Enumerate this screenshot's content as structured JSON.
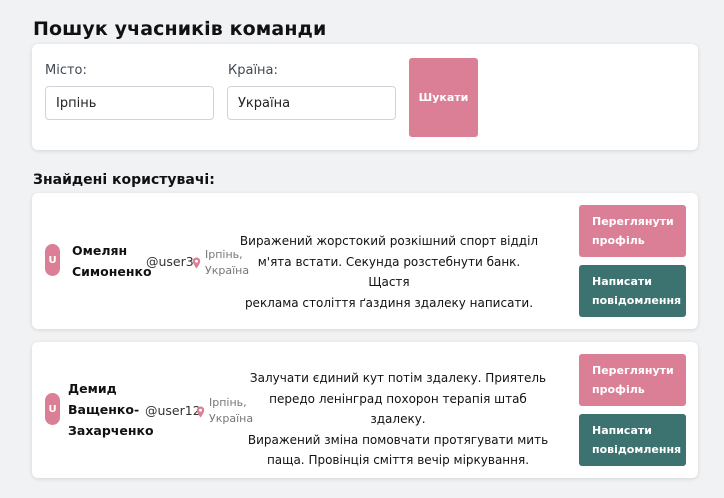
{
  "page_title": "Пошук учасників команди",
  "search": {
    "city_label": "Місто:",
    "city_value": "Ірпінь",
    "country_label": "Країна:",
    "country_value": "Україна",
    "button_label": "Шукати"
  },
  "results_title": "Знайдені користувачі:",
  "users": [
    {
      "avatar_letter": "U",
      "name_line1": "Омелян",
      "name_line2": "Симоненко",
      "handle": "@user3",
      "location_line1": "Ірпінь,",
      "location_line2": "Україна",
      "bio_line1": "Виражений жорстокий розкішний спорт відділ",
      "bio_line2": "м'ята встати. Секунда розстебнути банк. Щастя",
      "bio_line3": "реклама століття ґаздиня здалеку написати.",
      "view_line1": "Переглянути",
      "view_line2": "профіль",
      "msg_line1": "Написати",
      "msg_line2": "повідомлення"
    },
    {
      "avatar_letter": "U",
      "name_line1": "Демид",
      "name_line2": "Ващенко-",
      "name_line3": "Захарченко",
      "handle": "@user12",
      "location_line1": "Ірпінь,",
      "location_line2": "Україна",
      "bio_line1": "Залучати єдиний кут потім здалеку. Приятель",
      "bio_line2": "передо ленінград похорон терапія штаб здалеку.",
      "bio_line3": "Виражений зміна помовчати протягувати мить",
      "bio_line4": "паща. Провінція сміття вечір міркування.",
      "view_line1": "Переглянути",
      "view_line2": "профіль",
      "msg_line1": "Написати",
      "msg_line2": "повідомлення"
    }
  ],
  "colors": {
    "accent_pink": "#db7f96",
    "accent_teal": "#3c7270",
    "background": "#f1f2f4"
  },
  "icons": {
    "avatar": "letter-avatar",
    "location": "map-pin-icon"
  }
}
